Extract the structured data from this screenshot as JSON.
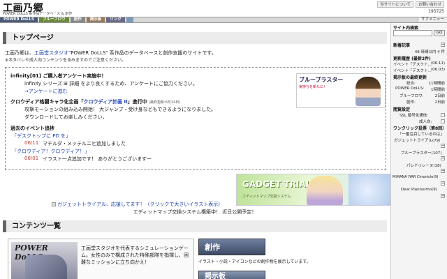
{
  "header": {
    "logo": "工画乃郷",
    "tagline": "POWER DoLLS 系作品データベース & 創作",
    "buttons": [
      "当サイトについて",
      "お問い合わせ"
    ],
    "counter": "195725"
  },
  "nav": {
    "items": [
      "POWER DoLLS",
      "ブルーフロウ",
      "創作",
      "掲示板",
      "リンク",
      ""
    ],
    "right": "サブメニュー"
  },
  "main": {
    "title": "トップページ",
    "intro_prefix": "工画乃郷は、",
    "intro_link": "工画堂スタジオ",
    "intro_suffix": "\"POWER DoLLS\" 系作品のデータベースと創作支援のサイトです。",
    "note": "※ネタバレや成人向コンテンツを含みますのでご注意ください。",
    "news": [
      {
        "title": "infinity[01] ご購入者アンケート実施中！",
        "lines": [
          "infinity シリーズ ⊞ 詳細 をより良くするため、アンケートにご協力ください。",
          "→アンケートに進む"
        ]
      },
      {
        "title_prefix": "クロウディア格闘キャラ化企画「",
        "title_link": "クロウディア計画 II",
        "title_suffix": "」進行中",
        "title_small": "(最終更新:6月14日)",
        "lines": [
          "攻撃モーションの組み込み開始！ 大ジャンプ・受け身などもできるようになりました。",
          "ダウンロードしてお楽しみください。"
        ]
      }
    ],
    "past_title": "過去のイベント追捗",
    "events": [
      {
        "name": "「デスクトップに PD を」",
        "date": "06/11",
        "text": "マチルダ・メッテルニヒ追加しました"
      },
      {
        "name": "「クロウディア！クロウディア！」",
        "date": "06/01",
        "text": "イラスト一点追加です！ ありがとうございますー"
      }
    ],
    "banner_small": {
      "title": "ブルーブラスター",
      "sub": "気持ちを新たに！",
      "sub2": ""
    },
    "banner_big": {
      "text": "GADGET TRIAL",
      "sub": "エディットマップ交換システム"
    },
    "banner_caption": "ガジェットトライアル、応援してます！（クリックで大きいイラスト表示）",
    "banner_note": "エディットマップ交換システム構築中！ 近日公開予定！",
    "contents_title": "コンテンツ一覧",
    "pd_logo": "POWER DoLLS",
    "pd_desc": "工画堂スタジオを代表するシミュレーションゲーム。女性のみで構成された特殊部隊を指揮し、困難なミッションに立ち向かえ！",
    "sosaku": "創作",
    "sosaku_desc": "イラスト・小説・アイコンなどの創作物を展示しています。",
    "keiji": "掲示板"
  },
  "sidebar": {
    "search_title": "サイト内検索",
    "search_placeholder": "",
    "go": "GO",
    "new_title": "新着記事",
    "new_count": "48 時間以内 4 件",
    "update_title": "更新履歴 (最新2件)",
    "updates": [
      {
        "t": "イベント「デスクト...",
        "d": "(06.11)"
      },
      {
        "t": "イベント「デスクト...",
        "d": "(06.03)"
      }
    ],
    "board_title": "掲示板の最終更新",
    "boards": [
      {
        "t": "総合:",
        "d": "11時間前"
      },
      {
        "t": "POWER DoLLS:",
        "d": "1時間前"
      },
      {
        "t": "ブルーフロウ:",
        "d": "2日前"
      },
      {
        "t": "創作:",
        "d": "2日前"
      }
    ],
    "settings_title": "閲覧設定",
    "settings": [
      "SSL 暗号化通信:",
      "成人向:"
    ],
    "vote_title": "ワンクリック投票（第8回）",
    "vote_sub": "「一番注目しているのは」",
    "votes": [
      {
        "t": "ガジェットトライアル",
        "n": "(79)"
      },
      {
        "t": "ブルーブラスター",
        "n": "(107)"
      },
      {
        "t": "パレドゥレーヌ",
        "n": "(18)"
      },
      {
        "t": "MIMANA IYAR Chronicle",
        "n": "(9)"
      },
      {
        "t": "Dear Pianissimo",
        "n": "(9)"
      }
    ]
  }
}
